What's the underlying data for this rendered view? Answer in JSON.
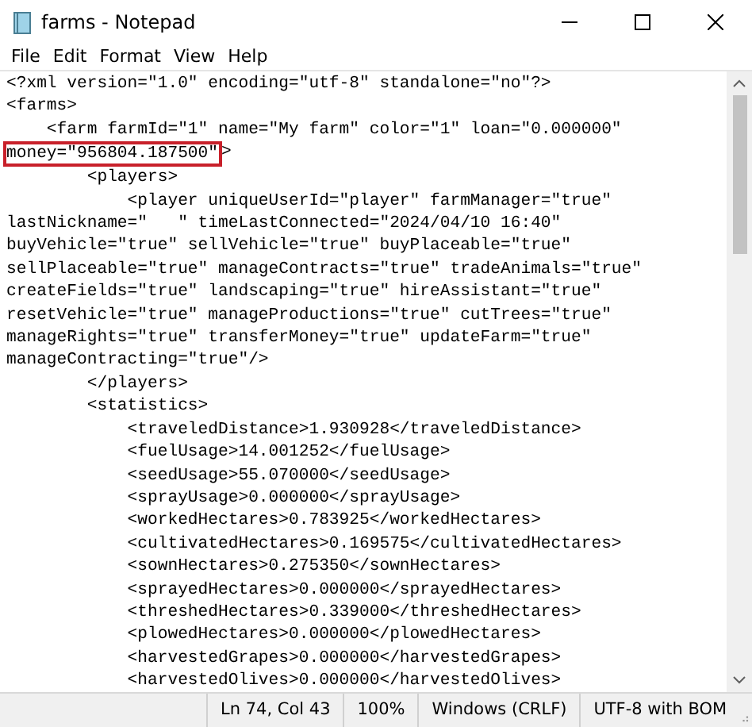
{
  "window": {
    "title": "farms - Notepad"
  },
  "menu": [
    {
      "label": "File"
    },
    {
      "label": "Edit"
    },
    {
      "label": "Format"
    },
    {
      "label": "View"
    },
    {
      "label": "Help"
    }
  ],
  "editor": {
    "lines": [
      {
        "segments": [
          {
            "text": "<?xml version=\"1.0\" encoding=\"utf-8\" standalone=\"no\"?>",
            "boxed": false
          }
        ]
      },
      {
        "segments": [
          {
            "text": "<farms>",
            "boxed": false
          }
        ]
      },
      {
        "segments": [
          {
            "text": "    <farm farmId=\"1\" name=\"My farm\" color=\"1\" loan=\"0.000000\"",
            "boxed": false
          }
        ]
      },
      {
        "segments": [
          {
            "text": "money=\"956804.187500\"",
            "boxed": true
          },
          {
            "text": ">",
            "boxed": false
          }
        ]
      },
      {
        "segments": [
          {
            "text": "        <players>",
            "boxed": false
          }
        ]
      },
      {
        "segments": [
          {
            "text": "            <player uniqueUserId=\"player\" farmManager=\"true\"",
            "boxed": false
          }
        ]
      },
      {
        "segments": [
          {
            "text": "lastNickname=\"   \" timeLastConnected=\"2024/04/10 16:40\"",
            "boxed": false
          }
        ]
      },
      {
        "segments": [
          {
            "text": "buyVehicle=\"true\" sellVehicle=\"true\" buyPlaceable=\"true\"",
            "boxed": false
          }
        ]
      },
      {
        "segments": [
          {
            "text": "sellPlaceable=\"true\" manageContracts=\"true\" tradeAnimals=\"true\"",
            "boxed": false
          }
        ]
      },
      {
        "segments": [
          {
            "text": "createFields=\"true\" landscaping=\"true\" hireAssistant=\"true\"",
            "boxed": false
          }
        ]
      },
      {
        "segments": [
          {
            "text": "resetVehicle=\"true\" manageProductions=\"true\" cutTrees=\"true\"",
            "boxed": false
          }
        ]
      },
      {
        "segments": [
          {
            "text": "manageRights=\"true\" transferMoney=\"true\" updateFarm=\"true\"",
            "boxed": false
          }
        ]
      },
      {
        "segments": [
          {
            "text": "manageContracting=\"true\"/>",
            "boxed": false
          }
        ]
      },
      {
        "segments": [
          {
            "text": "        </players>",
            "boxed": false
          }
        ]
      },
      {
        "segments": [
          {
            "text": "        <statistics>",
            "boxed": false
          }
        ]
      },
      {
        "segments": [
          {
            "text": "            <traveledDistance>1.930928</traveledDistance>",
            "boxed": false
          }
        ]
      },
      {
        "segments": [
          {
            "text": "            <fuelUsage>14.001252</fuelUsage>",
            "boxed": false
          }
        ]
      },
      {
        "segments": [
          {
            "text": "            <seedUsage>55.070000</seedUsage>",
            "boxed": false
          }
        ]
      },
      {
        "segments": [
          {
            "text": "            <sprayUsage>0.000000</sprayUsage>",
            "boxed": false
          }
        ]
      },
      {
        "segments": [
          {
            "text": "            <workedHectares>0.783925</workedHectares>",
            "boxed": false
          }
        ]
      },
      {
        "segments": [
          {
            "text": "            <cultivatedHectares>0.169575</cultivatedHectares>",
            "boxed": false
          }
        ]
      },
      {
        "segments": [
          {
            "text": "            <sownHectares>0.275350</sownHectares>",
            "boxed": false
          }
        ]
      },
      {
        "segments": [
          {
            "text": "            <sprayedHectares>0.000000</sprayedHectares>",
            "boxed": false
          }
        ]
      },
      {
        "segments": [
          {
            "text": "            <threshedHectares>0.339000</threshedHectares>",
            "boxed": false
          }
        ]
      },
      {
        "segments": [
          {
            "text": "            <plowedHectares>0.000000</plowedHectares>",
            "boxed": false
          }
        ]
      },
      {
        "segments": [
          {
            "text": "            <harvestedGrapes>0.000000</harvestedGrapes>",
            "boxed": false
          }
        ]
      },
      {
        "segments": [
          {
            "text": "            <harvestedOlives>0.000000</harvestedOlives>",
            "boxed": false
          }
        ]
      }
    ]
  },
  "status_bar": [
    {
      "text": "Ln 74, Col 43"
    },
    {
      "text": "100%"
    },
    {
      "text": "Windows (CRLF)"
    },
    {
      "text": "UTF-8 with BOM"
    }
  ]
}
